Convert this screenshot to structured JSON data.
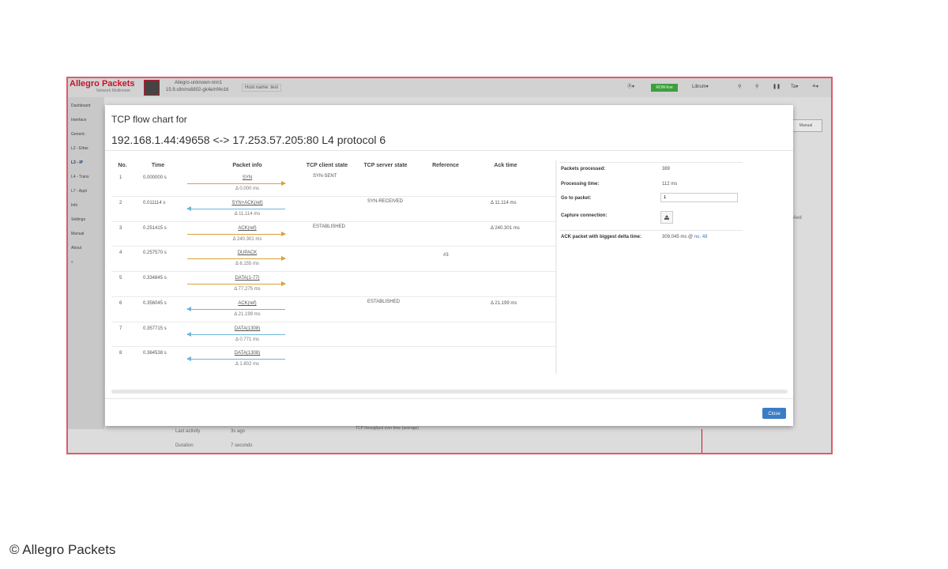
{
  "app": {
    "logo": "Allegro Packets",
    "logo_subtitle": "Network Multimeter",
    "device_line1": "Allegro-unknown-nnn1",
    "device_line2": "15.9.s8n/ns6802-gk4e/nf4n16",
    "hostname": "Host name: test",
    "header_buttons": [
      "Ⓐ▾",
      "ROW-live",
      "Lilirum▾",
      "Ta▾",
      "≗▾"
    ],
    "manual_button": "Manual",
    "sidebar": [
      "Dashboard",
      "Interface",
      "Generic",
      "L2 - Ether",
      "L3 - IP",
      "L4 - Trans",
      "L7 - Appl",
      "Info",
      "Settings",
      "Manual",
      "About",
      "«"
    ],
    "bottom_labels": [
      "Last activity",
      "Duration"
    ],
    "bottom_values": [
      "3s ago",
      "7 seconds"
    ],
    "bottom_legend": "TCP throughput over time (average)",
    "right_tab": "Aed"
  },
  "modal": {
    "title": "TCP flow chart for",
    "subtitle": "192.168.1.44:49658 <-> 17.253.57.205:80 L4 protocol 6",
    "columns": [
      "No.",
      "Time",
      "Packet info",
      "TCP client state",
      "TCP server state",
      "Reference",
      "Ack time"
    ],
    "rows": [
      {
        "no": "1",
        "time": "0.000000 s",
        "label": "SYN",
        "delta": "Δ 0.000 ms",
        "dir": "right",
        "client": "SYN-SENT",
        "server": "",
        "ref": "",
        "ack": ""
      },
      {
        "no": "2",
        "time": "0.011114 s",
        "label": "SYN+ACK(ref)",
        "delta": "Δ 11.114 ms",
        "dir": "left",
        "client": "",
        "server": "SYN-RECEIVED",
        "ref": "",
        "ack": "Δ 11.114 ms"
      },
      {
        "no": "3",
        "time": "0.251415 s",
        "label": "ACK(ref)",
        "delta": "Δ 240.301 ms",
        "dir": "right",
        "client": "ESTABLISHED",
        "server": "",
        "ref": "",
        "ack": "Δ 240.301 ms"
      },
      {
        "no": "4",
        "time": "0.257570 s",
        "label": "DUPACK",
        "delta": "Δ 6.155 ms",
        "dir": "right",
        "client": "",
        "server": "",
        "ref": "#3",
        "ack": ""
      },
      {
        "no": "5",
        "time": "0.334845 s",
        "label": "DATA(1-77)",
        "delta": "Δ 77.275 ms",
        "dir": "right",
        "client": "",
        "server": "",
        "ref": "",
        "ack": ""
      },
      {
        "no": "6",
        "time": "0.356045 s",
        "label": "ACK(ref)",
        "delta": "Δ 21.199 ms",
        "dir": "left",
        "client": "",
        "server": "ESTABLISHED",
        "ref": "",
        "ack": "Δ 21.199 ms"
      },
      {
        "no": "7",
        "time": "0.357715 s",
        "label": "DATA(1308)",
        "delta": "Δ 0.771 ms",
        "dir": "left",
        "client": "",
        "server": "",
        "ref": "",
        "ack": ""
      },
      {
        "no": "8",
        "time": "0.364538 s",
        "label": "DATA(1308)",
        "delta": "Δ 1.802 ms",
        "dir": "left",
        "client": "",
        "server": "",
        "ref": "",
        "ack": ""
      }
    ],
    "stats": {
      "packets_processed_label": "Packets processed:",
      "packets_processed_value": "389",
      "processing_time_label": "Processing time:",
      "processing_time_value": "112 ms",
      "goto_label": "Go to packet:",
      "goto_value": "1",
      "capture_label": "Capture connection:",
      "ack_label": "ACK packet with biggest delta time:",
      "ack_value": "309.045 ms @",
      "ack_link": "no. 48"
    },
    "close_label": "Close"
  },
  "watermark": "© Allegro Packets",
  "colors": {
    "client_arrow": "#d8a33c",
    "server_arrow": "#6db5dc",
    "accent": "#3a7dc4",
    "brand": "#c4162a"
  }
}
